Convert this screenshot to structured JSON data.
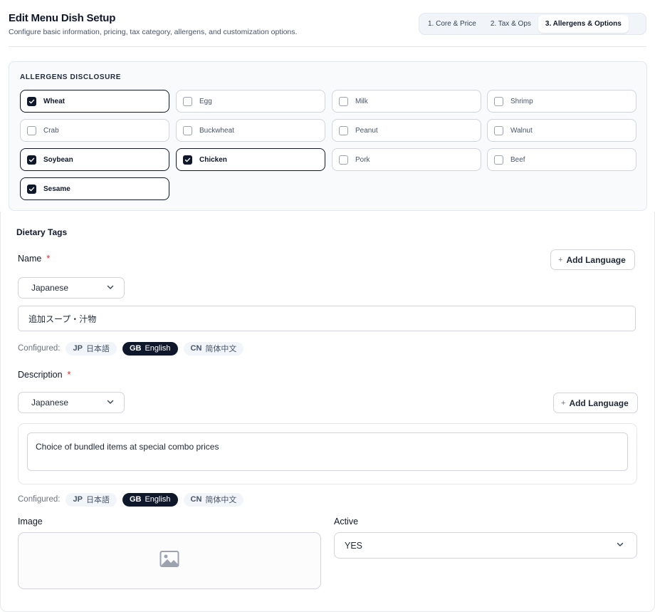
{
  "header": {
    "title": "Edit Menu Dish Setup",
    "subtitle": "Configure basic information, pricing, tax category, allergens, and customization options.",
    "steps": [
      "1. Core & Price",
      "2. Tax & Ops",
      "3. Allergens & Options"
    ],
    "active_step": 2
  },
  "allergens": {
    "section_label": "ALLERGENS DISCLOSURE",
    "items": [
      {
        "label": "Wheat",
        "checked": true
      },
      {
        "label": "Egg",
        "checked": false
      },
      {
        "label": "Milk",
        "checked": false
      },
      {
        "label": "Shrimp",
        "checked": false
      },
      {
        "label": "Crab",
        "checked": false
      },
      {
        "label": "Buckwheat",
        "checked": false
      },
      {
        "label": "Peanut",
        "checked": false
      },
      {
        "label": "Walnut",
        "checked": false
      },
      {
        "label": "Soybean",
        "checked": true
      },
      {
        "label": "Chicken",
        "checked": true
      },
      {
        "label": "Pork",
        "checked": false
      },
      {
        "label": "Beef",
        "checked": false
      },
      {
        "label": "Sesame",
        "checked": true
      }
    ]
  },
  "dietary": {
    "title": "Dietary Tags",
    "name": {
      "label": "Name",
      "required_mark": "*",
      "add_language_label": "Add Language",
      "language_select": "Japanese",
      "value": "追加スープ・汁物",
      "configured_label": "Configured:",
      "configured": [
        {
          "code": "JP",
          "name": "日本語",
          "active": false
        },
        {
          "code": "GB",
          "name": "English",
          "active": true
        },
        {
          "code": "CN",
          "name": "简体中文",
          "active": false
        }
      ]
    },
    "description": {
      "label": "Description",
      "required_mark": "*",
      "add_language_label": "Add Language",
      "language_select": "Japanese",
      "value": "Choice of bundled items at special combo prices",
      "configured_label": "Configured:",
      "configured": [
        {
          "code": "JP",
          "name": "日本語",
          "active": false
        },
        {
          "code": "GB",
          "name": "English",
          "active": true
        },
        {
          "code": "CN",
          "name": "简体中文",
          "active": false
        }
      ]
    },
    "image_label": "Image",
    "active_label": "Active",
    "active_value": "YES"
  },
  "colors": {
    "accent": "#0f172a",
    "required": "#dc2626",
    "border": "#d1d5db",
    "panel_bg": "#f8fafc"
  },
  "icons": {
    "chevron": "chevron-down-icon",
    "image_placeholder": "image-icon",
    "check": "check-icon",
    "plus": "plus-icon"
  }
}
